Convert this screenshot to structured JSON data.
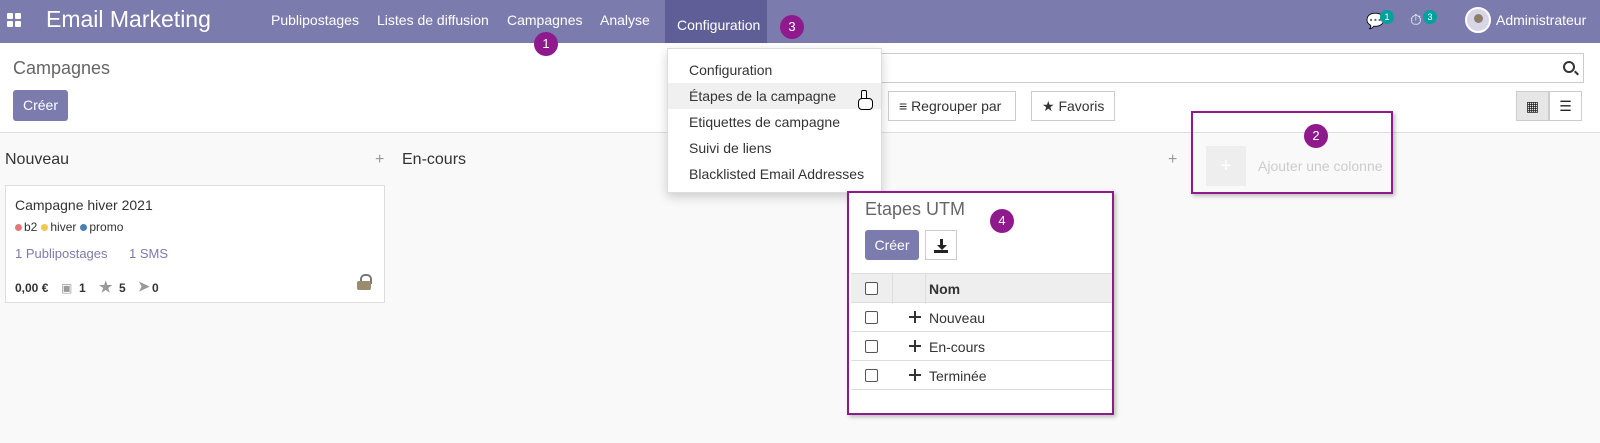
{
  "topbar": {
    "brand": "Email Marketing",
    "menu": [
      "Publipostages",
      "Listes de diffusion",
      "Campagnes",
      "Analyse"
    ],
    "active_menu": "Configuration",
    "messages_count": "1",
    "activities_count": "3",
    "user": "Administrateur"
  },
  "callouts": [
    "1",
    "2",
    "3",
    "4"
  ],
  "control": {
    "title": "Campagnes",
    "create_label": "Créer",
    "group_by_label": "Regrouper par",
    "favorites_label": "Favoris"
  },
  "dropdown": {
    "items": [
      "Configuration",
      "Étapes de la campagne",
      "Etiquettes de campagne",
      "Suivi de liens",
      "Blacklisted Email Addresses"
    ]
  },
  "kanban": {
    "columns": [
      "Nouveau",
      "En-cours"
    ],
    "add_column_label": "Ajouter une colonne",
    "card": {
      "title": "Campagne hiver 2021",
      "tags": [
        {
          "label": "b2",
          "color": "#e07a7a"
        },
        {
          "label": "hiver",
          "color": "#f0c84a"
        },
        {
          "label": "promo",
          "color": "#4a7fb0"
        }
      ],
      "mailings": "1 Publipostages",
      "sms": "1 SMS",
      "revenue": "0,00 €",
      "sent": "1",
      "opened": "5",
      "clicked": "0"
    }
  },
  "utm": {
    "title": "Etapes UTM",
    "create_label": "Créer",
    "column": "Nom",
    "rows": [
      "Nouveau",
      "En-cours",
      "Terminée"
    ]
  },
  "colors": {
    "brand": "#7c7bad",
    "active_menu": "#5f5e97",
    "callout": "#8e1a8e"
  }
}
